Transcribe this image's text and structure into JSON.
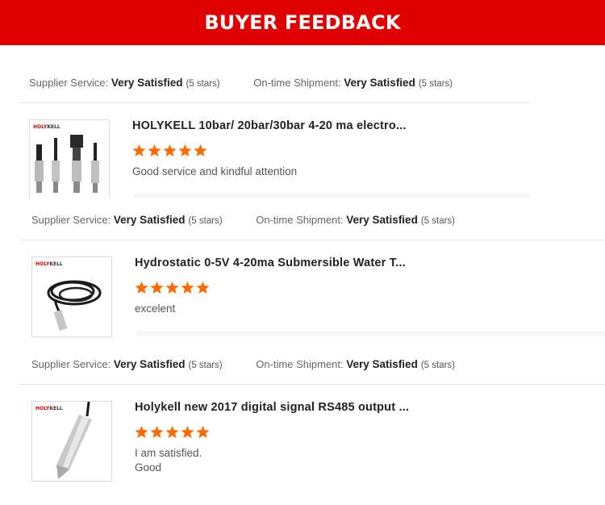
{
  "banner": {
    "title": "BUYER FEEDBACK"
  },
  "colors": {
    "brand_red": "#e10000",
    "star_orange": "#ff6a00"
  },
  "labels": {
    "supplier_service": "Supplier Service:",
    "ontime_shipment": "On-time Shipment:",
    "very_satisfied": "Very Satisfied",
    "five_stars": "(5 stars)"
  },
  "reviews": [
    {
      "title": "HOLYKELL 10bar/ 20bar/30bar 4-20 ma electro...",
      "rating": 5,
      "comment_lines": [
        "Good service and kindful attention"
      ],
      "image": "pressure-transmitters-product-photo"
    },
    {
      "title": "Hydrostatic 0-5V 4-20ma Submersible Water T...",
      "rating": 5,
      "comment_lines": [
        "excelent"
      ],
      "image": "submersible-level-sensor-cable-photo"
    },
    {
      "title": "Holykell new 2017 digital signal RS485 output ...",
      "rating": 5,
      "comment_lines": [
        "I am satisfied.",
        "Good"
      ],
      "image": "rs485-level-probe-photo"
    }
  ],
  "logo_text": {
    "brand": "HOLYKELL"
  },
  "icons": {
    "star": "star-icon"
  }
}
